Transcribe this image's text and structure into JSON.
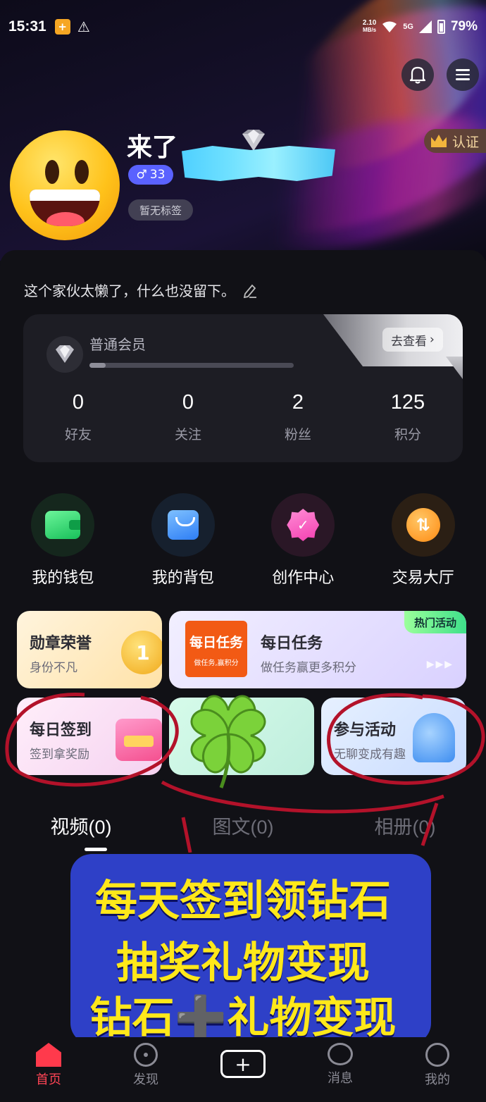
{
  "status_bar": {
    "time": "15:31",
    "net_speed_top": "2.10",
    "net_speed_bottom": "MB/s",
    "network": "5G",
    "battery": "79%"
  },
  "profile": {
    "username": "来了",
    "gender_symbol": "♂",
    "age": "33",
    "tag": "暂无标签",
    "verify_label": "认证",
    "bio": "这个家伙太懒了，什么也没留下。"
  },
  "member": {
    "level": "普通会员",
    "goto_label": "去查看",
    "progress": 0.08
  },
  "stats": [
    {
      "value": "0",
      "label": "好友"
    },
    {
      "value": "0",
      "label": "关注"
    },
    {
      "value": "2",
      "label": "粉丝"
    },
    {
      "value": "125",
      "label": "积分"
    }
  ],
  "quick_actions": [
    {
      "label": "我的钱包",
      "icon": "wallet-icon"
    },
    {
      "label": "我的背包",
      "icon": "bag-icon"
    },
    {
      "label": "创作中心",
      "icon": "creator-badge-icon"
    },
    {
      "label": "交易大厅",
      "icon": "exchange-coin-icon"
    }
  ],
  "cards": {
    "medal": {
      "title": "勋章荣誉",
      "subtitle": "身份不凡",
      "coin_text": "1"
    },
    "task": {
      "title": "每日任务",
      "subtitle": "做任务赢更多积分",
      "logo_title": "每日任务",
      "logo_subtitle": "做任务,赢积分",
      "hot_label": "热门活动"
    },
    "sign": {
      "title": "每日签到",
      "subtitle": "签到拿奖励"
    },
    "join": {
      "title": "参与活动",
      "subtitle": "无聊变成有趣"
    }
  },
  "tabs": [
    {
      "label": "视频(0)"
    },
    {
      "label": "图文(0)"
    },
    {
      "label": "相册(0)"
    }
  ],
  "promo": {
    "line1": "每天签到领钻石",
    "line2": "抽奖礼物变现",
    "line3": "钻石➕礼物变现"
  },
  "bottom_nav": [
    {
      "label": "首页"
    },
    {
      "label": "发现"
    },
    {
      "label": ""
    },
    {
      "label": "消息"
    },
    {
      "label": "我的"
    }
  ],
  "colors": {
    "accent_red": "#ff3a4c",
    "promo_text": "#ffe81a",
    "promo_bg": "#2e40c7",
    "gender_badge": "#5a62ff"
  }
}
